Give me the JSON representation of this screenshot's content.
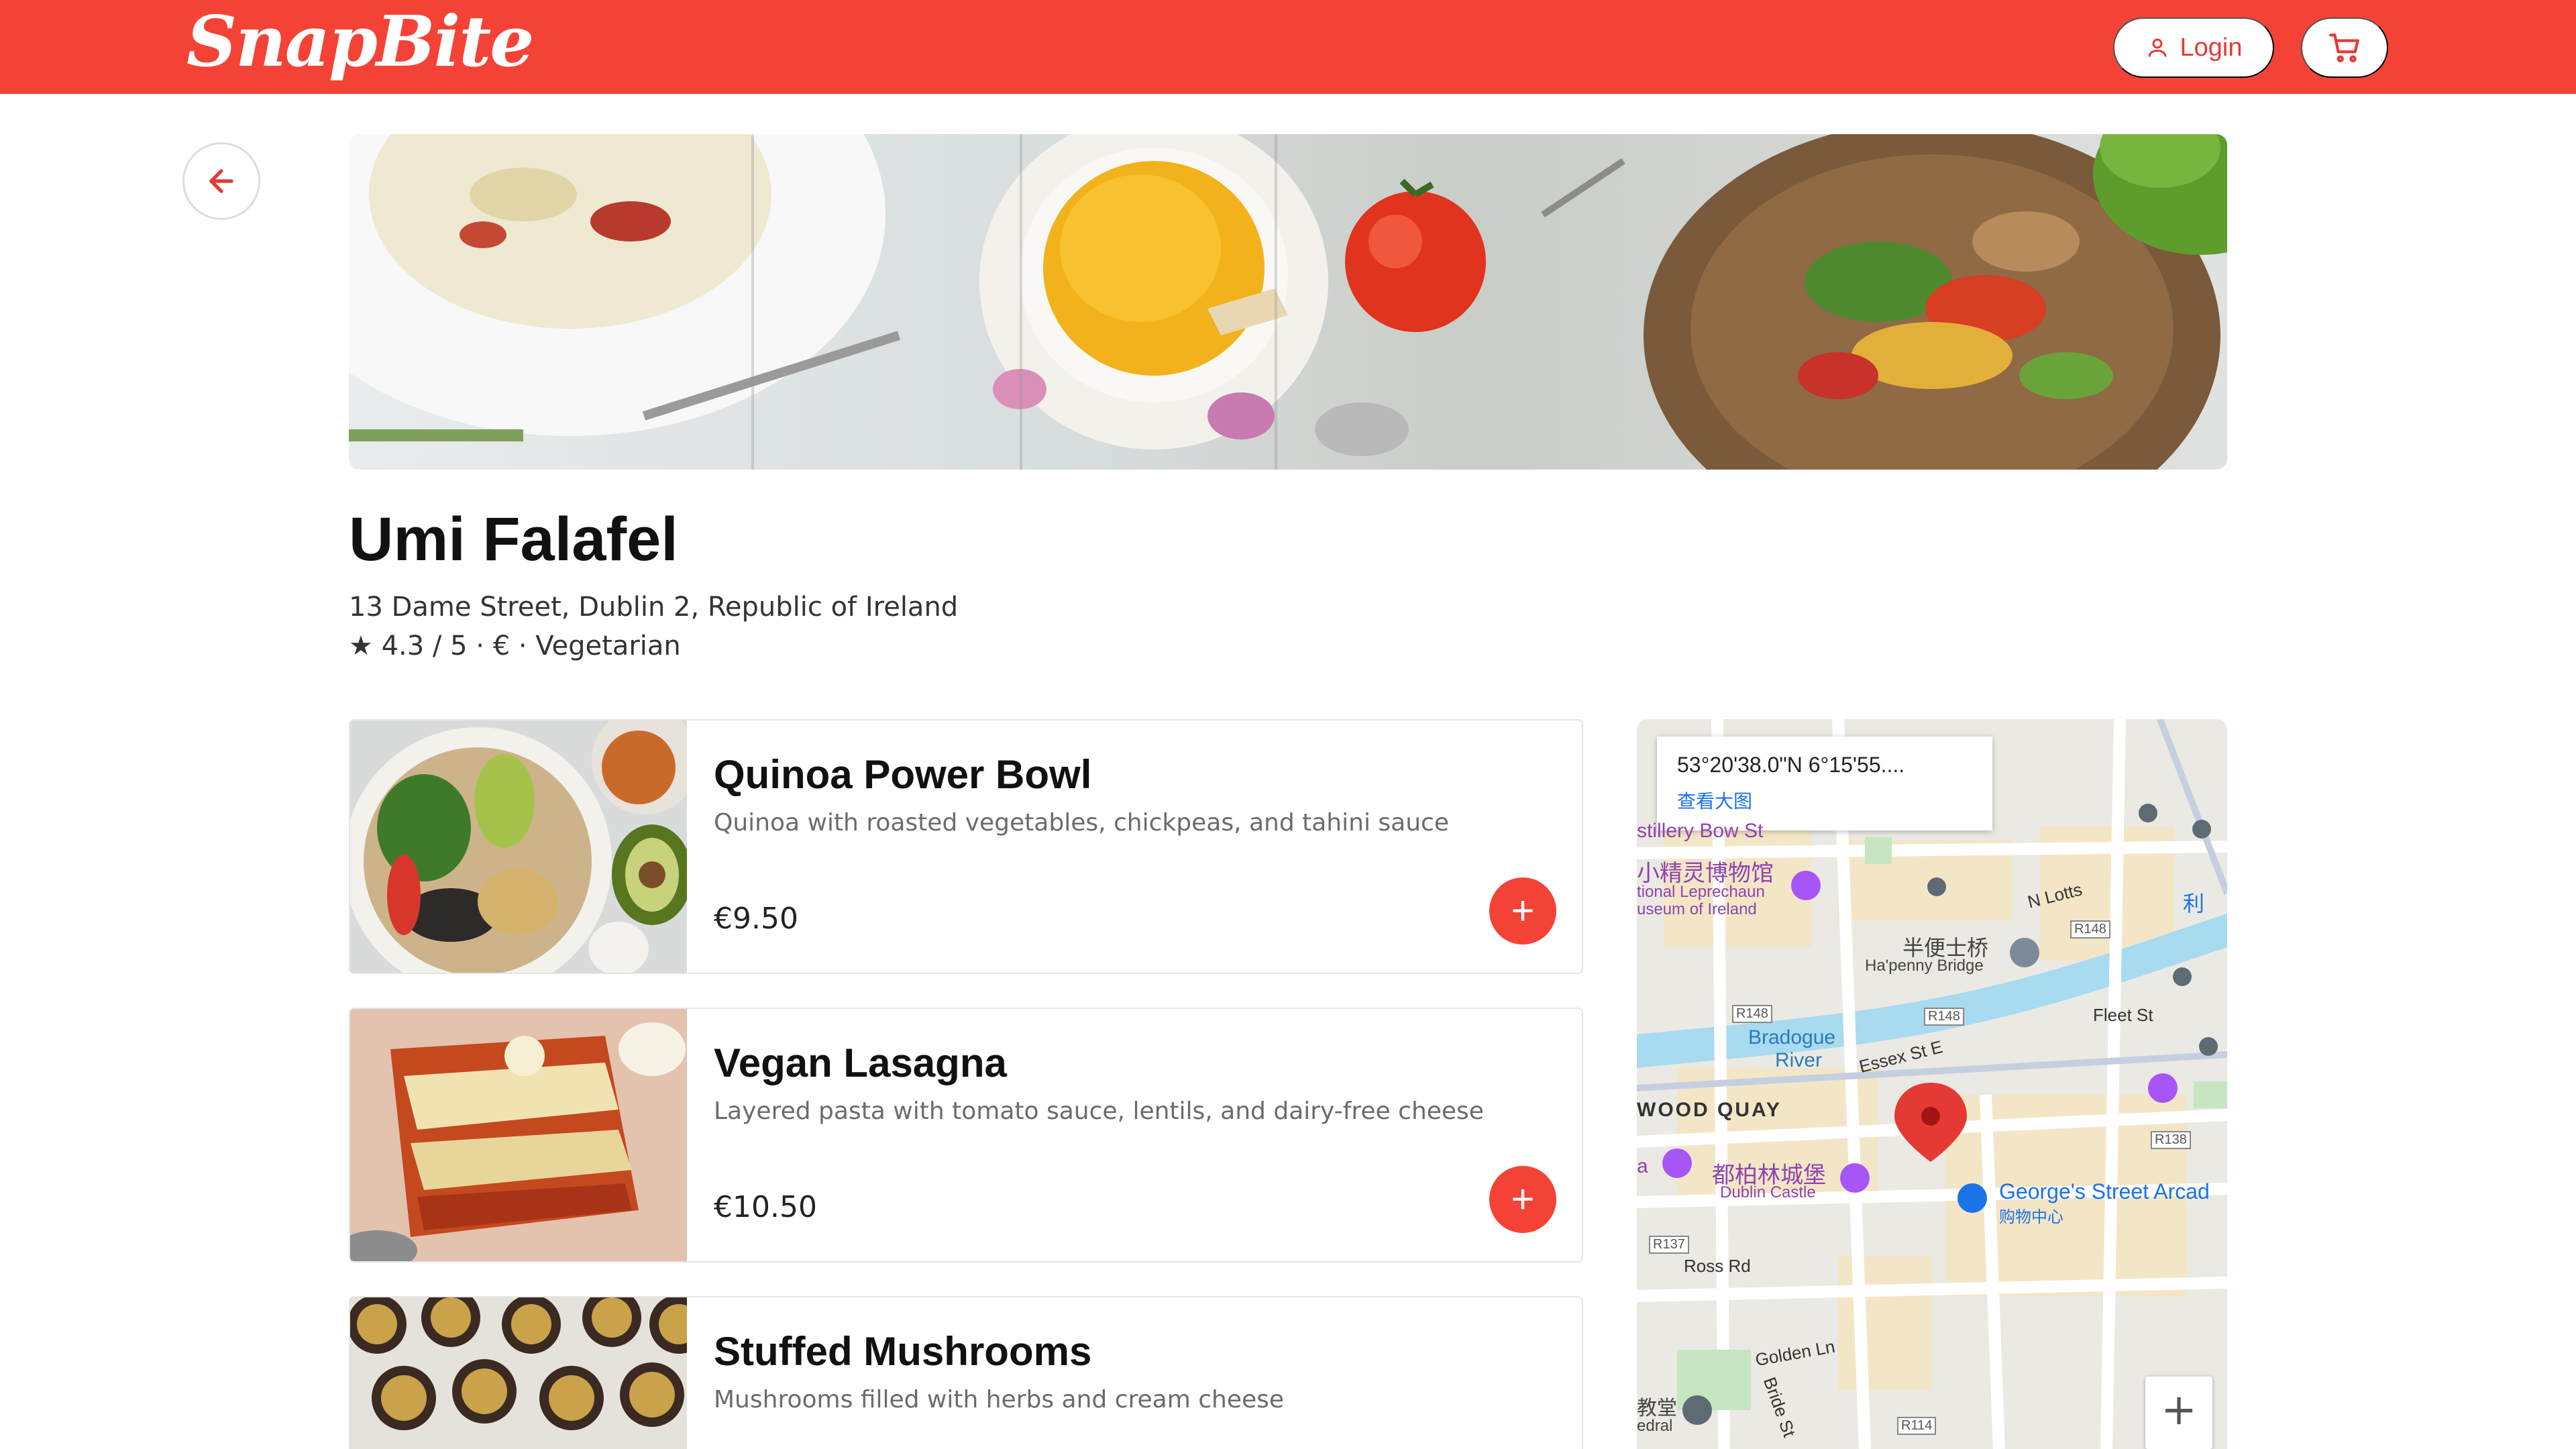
{
  "header": {
    "logo": "SnapBite",
    "login_label": "Login",
    "brand_color": "#f44336"
  },
  "back": {
    "icon": "arrow-left-icon"
  },
  "restaurant": {
    "name": "Umi Falafel",
    "address": "13 Dame Street, Dublin 2, Republic of Ireland",
    "meta": "★ 4.3 / 5 · € · Vegetarian"
  },
  "menu": [
    {
      "title": "Quinoa Power Bowl",
      "description": "Quinoa with roasted vegetables, chickpeas, and tahini sauce",
      "price": "€9.50"
    },
    {
      "title": "Vegan Lasagna",
      "description": "Layered pasta with tomato sauce, lentils, and dairy-free cheese",
      "price": "€10.50"
    },
    {
      "title": "Stuffed Mushrooms",
      "description": "Mushrooms filled with herbs and cream cheese",
      "price": ""
    }
  ],
  "map": {
    "popup_coords": "53°20'38.0\"N 6°15'55....",
    "popup_link": "查看大图",
    "labels": {
      "distillery": "stillery Bow St",
      "museum_cn": "小精灵博物馆",
      "museum_en1": "tional Leprechaun",
      "museum_en2": "useum of Ireland",
      "nlotts": "N Lotts",
      "bridge_cn": "半便士桥",
      "bridge_en": "Ha'penny Bridge",
      "fleet": "Fleet St",
      "bradogue1": "Bradogue",
      "bradogue2": "River",
      "essex": "Essex St E",
      "woodquay": "WOOD QUAY",
      "castle_cn": "都柏林城堡",
      "castle_en": "Dublin Castle",
      "arcade_en": "George's Street Arcad",
      "arcade_cn": "购物中心",
      "rossrd": "Ross Rd",
      "golden": "Golden Ln",
      "bride": "Bride St",
      "cathedral_cn": "教堂",
      "cathedral_en": "edral",
      "r148a": "R148",
      "r148b": "R148",
      "r148c": "R148",
      "r138": "R138",
      "r137": "R137",
      "r114": "R114",
      "li": "利",
      "a": "a"
    },
    "zoom_in": "+"
  }
}
